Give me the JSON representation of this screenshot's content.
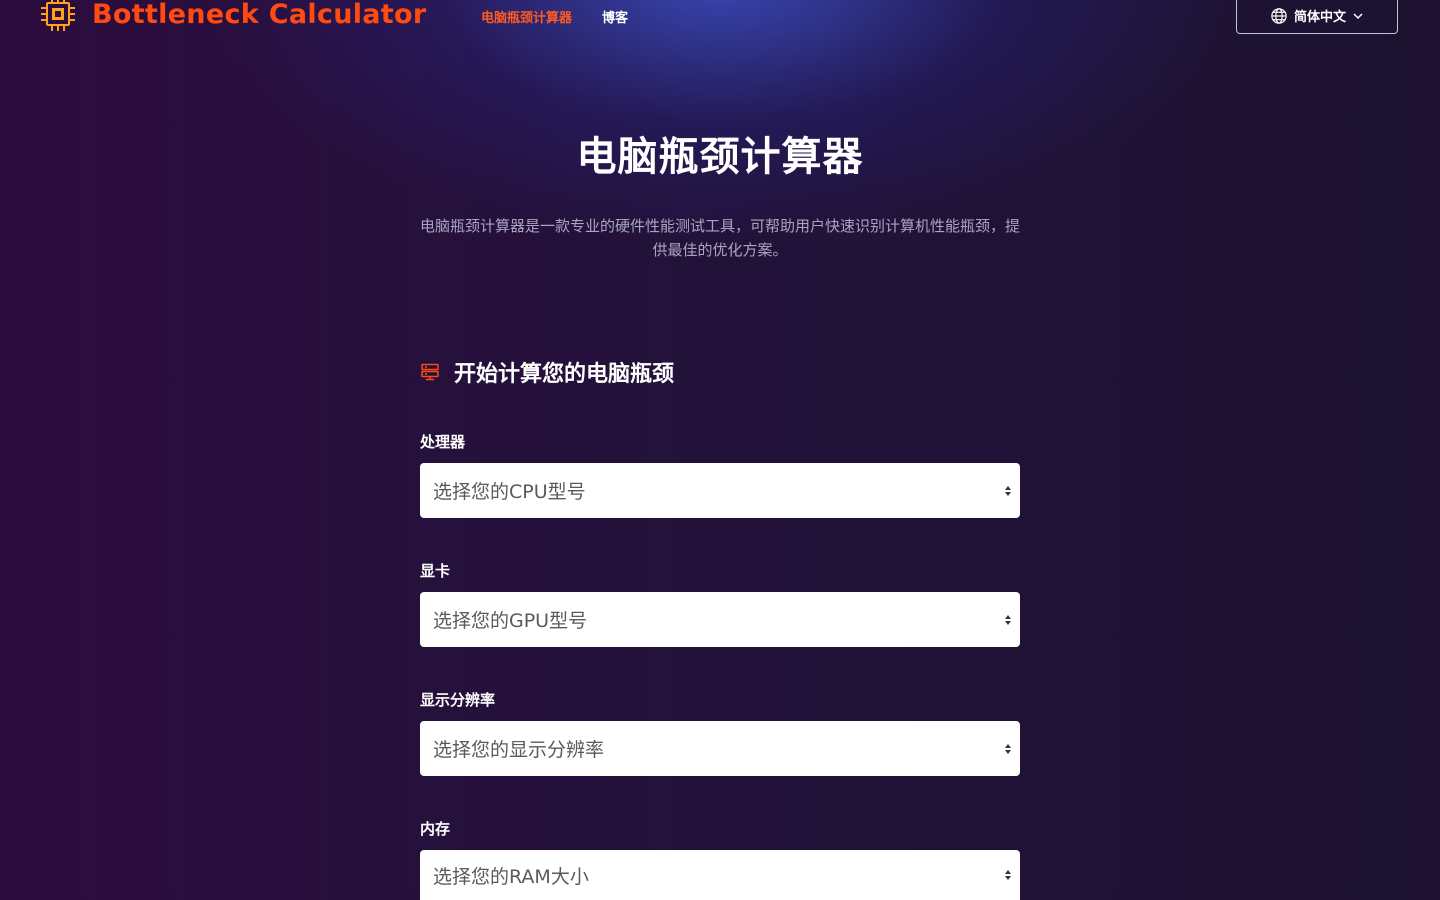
{
  "header": {
    "logo_text": "Bottleneck Calculator",
    "nav": [
      {
        "label": "电脑瓶颈计算器",
        "active": true
      },
      {
        "label": "博客",
        "active": false
      }
    ],
    "language": "简体中文"
  },
  "hero": {
    "title": "电脑瓶颈计算器",
    "description": "电脑瓶颈计算器是一款专业的硬件性能测试工具，可帮助用户快速识别计算机性能瓶颈，提供最佳的优化方案。"
  },
  "form": {
    "heading": "开始计算您的电脑瓶颈",
    "fields": [
      {
        "label": "处理器",
        "placeholder": "选择您的CPU型号"
      },
      {
        "label": "显卡",
        "placeholder": "选择您的GPU型号"
      },
      {
        "label": "显示分辨率",
        "placeholder": "选择您的显示分辨率"
      },
      {
        "label": "内存",
        "placeholder": "选择您的RAM大小"
      }
    ]
  },
  "colors": {
    "accent": "#ff4a12",
    "nav_active": "#ff5a1f",
    "background": "#22123a",
    "muted_text": "#a9a4c0"
  },
  "icons": {
    "logo": "cpu-chip-icon",
    "language": "globe-icon",
    "language_dropdown": "chevron-down-icon",
    "section": "server-icon"
  }
}
